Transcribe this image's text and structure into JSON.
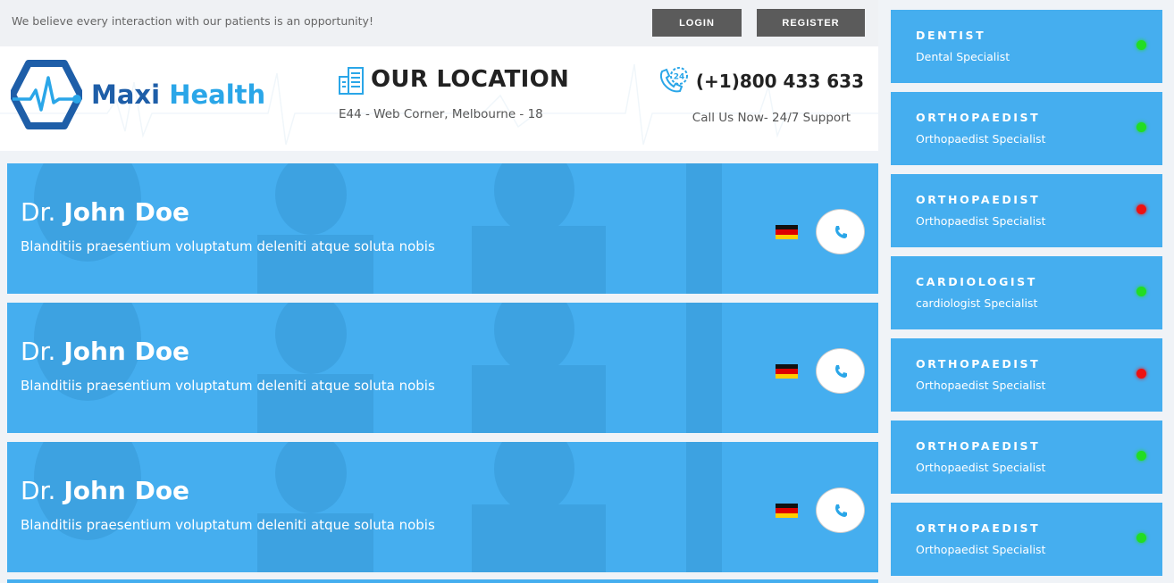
{
  "topbar": {
    "tagline": "We believe every interaction with our patients is an opportunity!",
    "login_label": "LOGIN",
    "register_label": "REGISTER"
  },
  "header": {
    "logo": {
      "part1": "Maxi",
      "part2": "Health"
    },
    "location": {
      "title": "OUR LOCATION",
      "address": "E44 - Web Corner, Melbourne - 18",
      "icon": "building-icon"
    },
    "phone": {
      "number": "(+1)800 433 633",
      "subtitle": "Call Us Now- 24/7 Support",
      "icon": "phone-24-icon"
    }
  },
  "doctors": [
    {
      "prefix": "Dr.",
      "name": "John Doe",
      "description": "Blanditiis praesentium voluptatum deleniti atque soluta nobis",
      "flag": "germany-flag-icon"
    },
    {
      "prefix": "Dr.",
      "name": "John Doe",
      "description": "Blanditiis praesentium voluptatum deleniti atque soluta nobis",
      "flag": "germany-flag-icon"
    },
    {
      "prefix": "Dr.",
      "name": "John Doe",
      "description": "Blanditiis praesentium voluptatum deleniti atque soluta nobis",
      "flag": "germany-flag-icon"
    }
  ],
  "specialists": [
    {
      "title": "DENTIST",
      "subtitle": "Dental Specialist",
      "status": "online"
    },
    {
      "title": "ORTHOPAEDIST",
      "subtitle": "Orthopaedist Specialist",
      "status": "online"
    },
    {
      "title": "ORTHOPAEDIST",
      "subtitle": "Orthopaedist Specialist",
      "status": "offline"
    },
    {
      "title": "CARDIOLOGIST",
      "subtitle": "cardiologist Specialist",
      "status": "online"
    },
    {
      "title": "ORTHOPAEDIST",
      "subtitle": "Orthopaedist Specialist",
      "status": "offline"
    },
    {
      "title": "ORTHOPAEDIST",
      "subtitle": "Orthopaedist Specialist",
      "status": "online"
    },
    {
      "title": "ORTHOPAEDIST",
      "subtitle": "Orthopaedist Specialist",
      "status": "online"
    }
  ],
  "colors": {
    "card_blue": "#45aeef",
    "online": "#22dd22",
    "offline": "#ee1111",
    "button_gray": "#5b5b5b",
    "logo_dark": "#1e5ea8",
    "logo_light": "#2aa6e8"
  }
}
